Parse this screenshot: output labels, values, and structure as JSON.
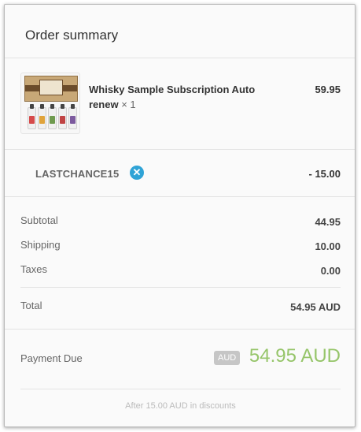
{
  "summary": {
    "title": "Order summary"
  },
  "line_item": {
    "name": "Whisky Sample Subscription Auto renew",
    "quantity": "× 1",
    "price": "59.95",
    "image_icon": "whisky-sample-box-icon"
  },
  "discount": {
    "code": "LASTCHANCE15",
    "amount": "- 15.00",
    "remove_icon": "close-icon"
  },
  "totals": {
    "subtotal_label": "Subtotal",
    "subtotal_value": "44.95",
    "shipping_label": "Shipping",
    "shipping_value": "10.00",
    "taxes_label": "Taxes",
    "taxes_value": "0.00",
    "total_label": "Total",
    "total_value": "54.95 AUD"
  },
  "payment": {
    "label": "Payment Due",
    "currency_badge": "AUD",
    "amount": "54.95 AUD",
    "accent_color": "#96c56a",
    "note": "After 15.00 AUD in discounts"
  }
}
